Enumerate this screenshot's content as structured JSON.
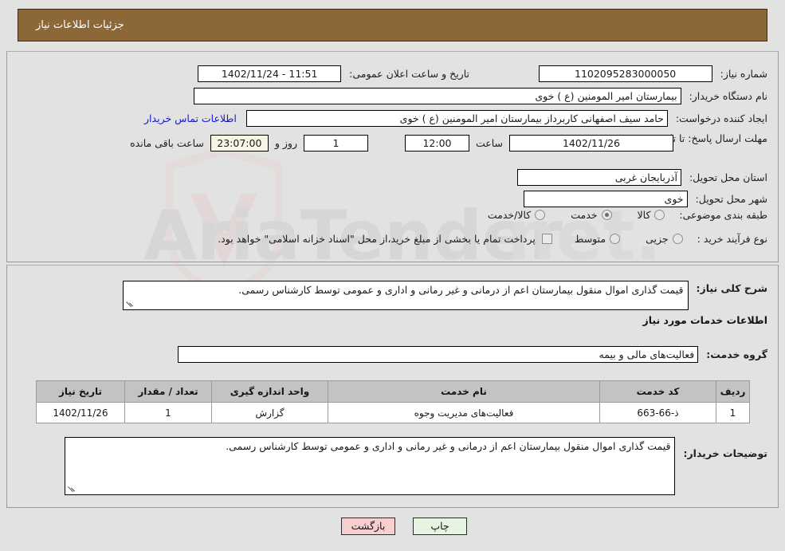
{
  "header": {
    "title": "جزئیات اطلاعات نیاز"
  },
  "form": {
    "need_number_label": "شماره نیاز:",
    "need_number_value": "1102095283000050",
    "public_announce_label": "تاریخ و ساعت اعلان عمومی:",
    "public_announce_value": "11:51 - 1402/11/24",
    "buyer_org_label": "نام دستگاه خریدار:",
    "buyer_org_value": "بیمارستان امیر المومنین (ع ) خوی",
    "requester_label": "ایجاد کننده درخواست:",
    "requester_value": "حامد سیف اصفهانی کاربرداز بیمارستان امیر المومنین (ع ) خوی",
    "buyer_contact_link": "اطلاعات تماس خریدار",
    "deadline_label": "مهلت ارسال پاسخ: تا تاریخ:",
    "deadline_date": "1402/11/26",
    "hour_label": "ساعت",
    "hour_value": "12:00",
    "days_value": "1",
    "days_label": "روز و",
    "remaining_value": "23:07:00",
    "remaining_label": "ساعت باقی مانده",
    "province_label": "استان محل تحویل:",
    "province_value": "آذربایجان غربی",
    "city_label": "شهر محل تحویل:",
    "city_value": "خوی",
    "category_label": "طبقه بندی موضوعی:",
    "category_options": [
      "کالا",
      "خدمت",
      "کالا/خدمت"
    ],
    "category_selected": "خدمت",
    "process_label": "نوع فرآیند خرید :",
    "process_options": [
      "جزیی",
      "متوسط"
    ],
    "process_selected": "",
    "treasury_checkbox_text": "پرداخت تمام یا بخشی از مبلغ خرید،از محل \"اسناد خزانه اسلامی\" خواهد بود.",
    "treasury_checked": false
  },
  "need_summary": {
    "label": "شرح کلی نیاز:",
    "value": "قیمت گذاری اموال منقول بیمارستان اعم از درمانی و غیر رمانی و اداری و عمومی توسط کارشناس رسمی."
  },
  "services_section": {
    "heading": "اطلاعات خدمات مورد نیاز",
    "group_label": "گروه خدمت:",
    "group_value": "فعالیت‌های مالی و بیمه",
    "table": {
      "columns": [
        "ردیف",
        "کد خدمت",
        "نام خدمت",
        "واحد اندازه گیری",
        "تعداد / مقدار",
        "تاریخ نیاز"
      ],
      "rows": [
        {
          "row": "1",
          "code": "ذ-66-663",
          "name": "فعالیت‌های مدیریت وجوه",
          "unit": "گزارش",
          "qty": "1",
          "date": "1402/11/26"
        }
      ]
    }
  },
  "buyer_notes": {
    "label": "توضیحات خریدار:",
    "value": "قیمت گذاری اموال منقول بیمارستان اعم از درمانی و غیر رمانی و اداری و عمومی توسط کارشناس رسمی."
  },
  "footer": {
    "back_label": "بازگشت",
    "print_label": "چاپ"
  },
  "watermark": {
    "text": "AriaTender.net"
  },
  "colors": {
    "header_bg": "#8c6839",
    "page_bg": "#e2e2e2",
    "link": "#1118cc",
    "back_btn": "#f8cfcf",
    "print_btn": "#e6f5e2",
    "table_header": "#c3c3c3"
  }
}
